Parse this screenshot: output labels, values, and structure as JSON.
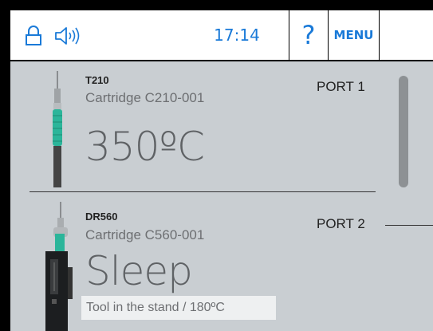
{
  "topbar": {
    "time": "17:14",
    "help_label": "?",
    "menu_label": "MENU",
    "icons": [
      "lock-icon",
      "speaker-icon"
    ]
  },
  "ports": [
    {
      "model": "T210",
      "cartridge_label": "Cartridge  C210-001",
      "value": "350ºC",
      "port_label": "PORT 1"
    },
    {
      "model": "DR560",
      "cartridge_label": "Cartridge  C560-001",
      "value": "Sleep",
      "port_label": "PORT 2",
      "status": "Tool in the stand  / 180ºC"
    }
  ],
  "colors": {
    "accent": "#1a7ad8",
    "panel": "#c9ced2",
    "tool_green": "#2bb59a"
  }
}
